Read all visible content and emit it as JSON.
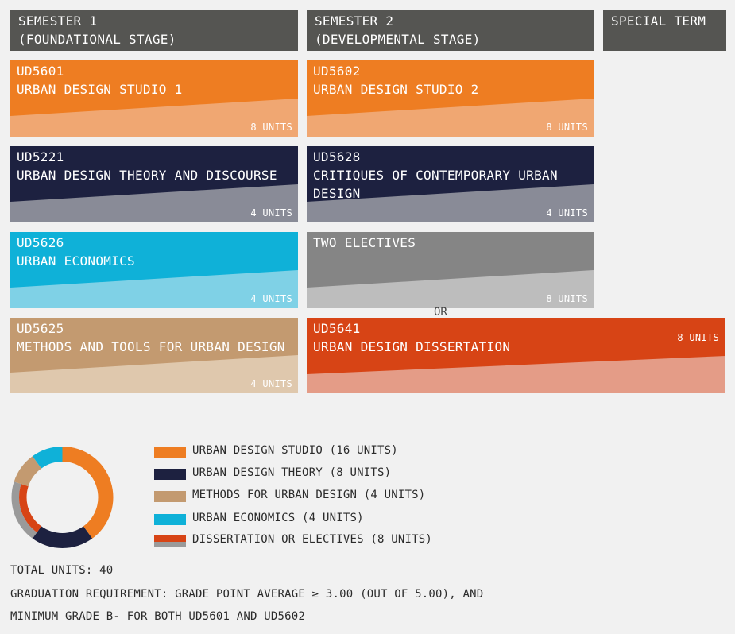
{
  "headers": {
    "sem1_line1": "SEMESTER 1",
    "sem1_line2": "(FOUNDATIONAL STAGE)",
    "sem2_line1": "SEMESTER 2",
    "sem2_line2": "(DEVELOPMENTAL STAGE)",
    "special": "SPECIAL TERM"
  },
  "colors": {
    "header": "#555552",
    "studio": "#ee7d22",
    "theory": "#1d2140",
    "economics": "#0fb1d8",
    "methods": "#c39a70",
    "electives": "#858585",
    "dissertation": "#d74415"
  },
  "modules": {
    "ud5601": {
      "code": "UD5601",
      "name": "URBAN DESIGN STUDIO 1",
      "units": "8 UNITS"
    },
    "ud5602": {
      "code": "UD5602",
      "name": "URBAN DESIGN STUDIO 2",
      "units": "8 UNITS"
    },
    "ud5221": {
      "code": "UD5221",
      "name": "URBAN DESIGN THEORY AND DISCOURSE",
      "units": "4 UNITS"
    },
    "ud5628": {
      "code": "UD5628",
      "name": "CRITIQUES OF CONTEMPORARY URBAN DESIGN",
      "units": "4 UNITS"
    },
    "ud5626": {
      "code": "UD5626",
      "name": "URBAN ECONOMICS",
      "units": "4 UNITS"
    },
    "electives": {
      "name": "TWO ELECTIVES",
      "units": "8 UNITS"
    },
    "ud5625": {
      "code": "UD5625",
      "name": "METHODS AND TOOLS FOR URBAN DESIGN",
      "units": "4 UNITS"
    },
    "ud5641": {
      "code": "UD5641",
      "name": "URBAN DESIGN DISSERTATION",
      "units": "8 UNITS"
    }
  },
  "or_label": "OR",
  "chart_data": {
    "type": "pie",
    "series": [
      {
        "label": "URBAN DESIGN STUDIO (16 UNITS)",
        "value": 16,
        "color": "#ee7d22"
      },
      {
        "label": "URBAN DESIGN THEORY (8 UNITS)",
        "value": 8,
        "color": "#1d2140"
      },
      {
        "label": "DISSERTATION OR ELECTIVES (8 UNITS)",
        "value": 8,
        "color": "#d74415",
        "alt_color": "#9a9a9a"
      },
      {
        "label": "METHODS FOR URBAN DESIGN (4 UNITS)",
        "value": 4,
        "color": "#c39a70"
      },
      {
        "label": "URBAN ECONOMICS (4 UNITS)",
        "value": 4,
        "color": "#0fb1d8"
      }
    ]
  },
  "legend": [
    "URBAN DESIGN STUDIO (16 UNITS)",
    "URBAN DESIGN THEORY (8 UNITS)",
    "METHODS FOR URBAN DESIGN (4 UNITS)",
    "URBAN ECONOMICS (4 UNITS)",
    "DISSERTATION OR ELECTIVES (8 UNITS)"
  ],
  "footer": {
    "total": "TOTAL UNITS: 40",
    "req1": "GRADUATION REQUIREMENT: GRADE POINT AVERAGE ≥ 3.00 (OUT OF 5.00), AND",
    "req2": "MINIMUM GRADE B- FOR BOTH UD5601 AND UD5602"
  }
}
